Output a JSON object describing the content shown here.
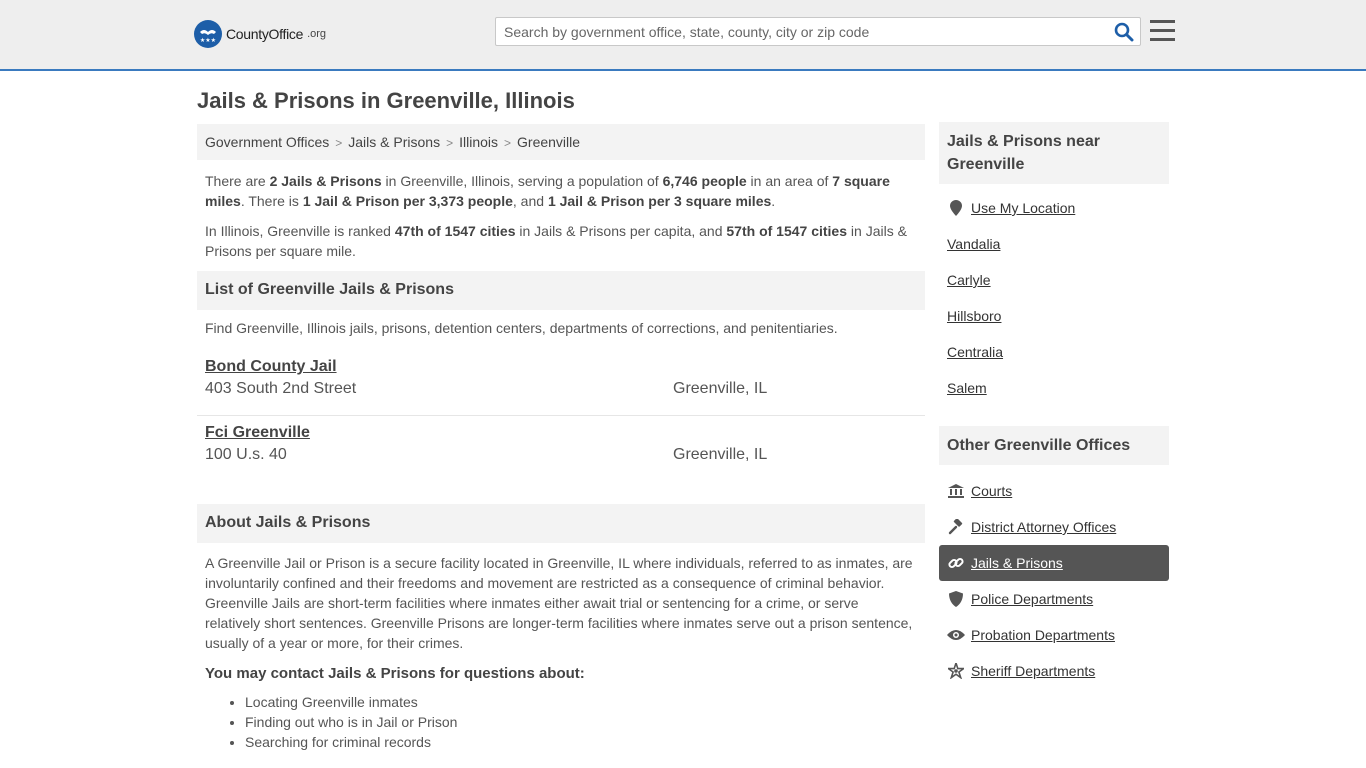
{
  "header": {
    "logo_name": "CountyOffice",
    "logo_tld": ".org",
    "search_placeholder": "Search by government office, state, county, city or zip code"
  },
  "page_title": "Jails & Prisons in Greenville, Illinois",
  "breadcrumb": [
    "Government Offices",
    "Jails & Prisons",
    "Illinois",
    "Greenville"
  ],
  "intro": {
    "p1": {
      "t1": "There are ",
      "b1": "2 Jails & Prisons",
      "t2": " in Greenville, Illinois, serving a population of ",
      "b2": "6,746 people",
      "t3": " in an area of ",
      "b3": "7 square miles",
      "t4": ". There is ",
      "b4": "1 Jail & Prison per 3,373 people",
      "t5": ", and ",
      "b5": "1 Jail & Prison per 3 square miles",
      "t6": "."
    },
    "p2": {
      "t1": "In Illinois, Greenville is ranked ",
      "b1": "47th of 1547 cities",
      "t2": " in Jails & Prisons per capita, and ",
      "b2": "57th of 1547 cities",
      "t3": " in Jails & Prisons per square mile."
    }
  },
  "list": {
    "heading": "List of Greenville Jails & Prisons",
    "description": "Find Greenville, Illinois jails, prisons, detention centers, departments of corrections, and penitentiaries.",
    "items": [
      {
        "name": "Bond County Jail",
        "address": "403 South 2nd Street",
        "city": "Greenville, IL"
      },
      {
        "name": "Fci Greenville",
        "address": "100 U.s. 40",
        "city": "Greenville, IL"
      }
    ]
  },
  "about": {
    "heading": "About Jails & Prisons",
    "text": "A Greenville Jail or Prison is a secure facility located in Greenville, IL where individuals, referred to as inmates, are involuntarily confined and their freedoms and movement are restricted as a consequence of criminal behavior. Greenville Jails are short-term facilities where inmates either await trial or sentencing for a crime, or serve relatively short sentences. Greenville Prisons are longer-term facilities where inmates serve out a prison sentence, usually of a year or more, for their crimes.",
    "contact_heading": "You may contact Jails & Prisons for questions about:",
    "bullets": [
      "Locating Greenville inmates",
      "Finding out who is in Jail or Prison",
      "Searching for criminal records"
    ]
  },
  "sidebar": {
    "nearby_heading": "Jails & Prisons near Greenville",
    "use_location": "Use My Location",
    "nearby": [
      "Vandalia",
      "Carlyle",
      "Hillsboro",
      "Centralia",
      "Salem"
    ],
    "other_heading": "Other Greenville Offices",
    "offices": [
      {
        "label": "Courts",
        "icon": "courthouse-icon"
      },
      {
        "label": "District Attorney Offices",
        "icon": "gavel-icon"
      },
      {
        "label": "Jails & Prisons",
        "icon": "link-icon"
      },
      {
        "label": "Police Departments",
        "icon": "shield-icon"
      },
      {
        "label": "Probation Departments",
        "icon": "eye-icon"
      },
      {
        "label": "Sheriff Departments",
        "icon": "star-icon"
      }
    ]
  },
  "colors": {
    "accent": "#3a7abf",
    "logo": "#1d5ea8",
    "active_bg": "#555555"
  }
}
